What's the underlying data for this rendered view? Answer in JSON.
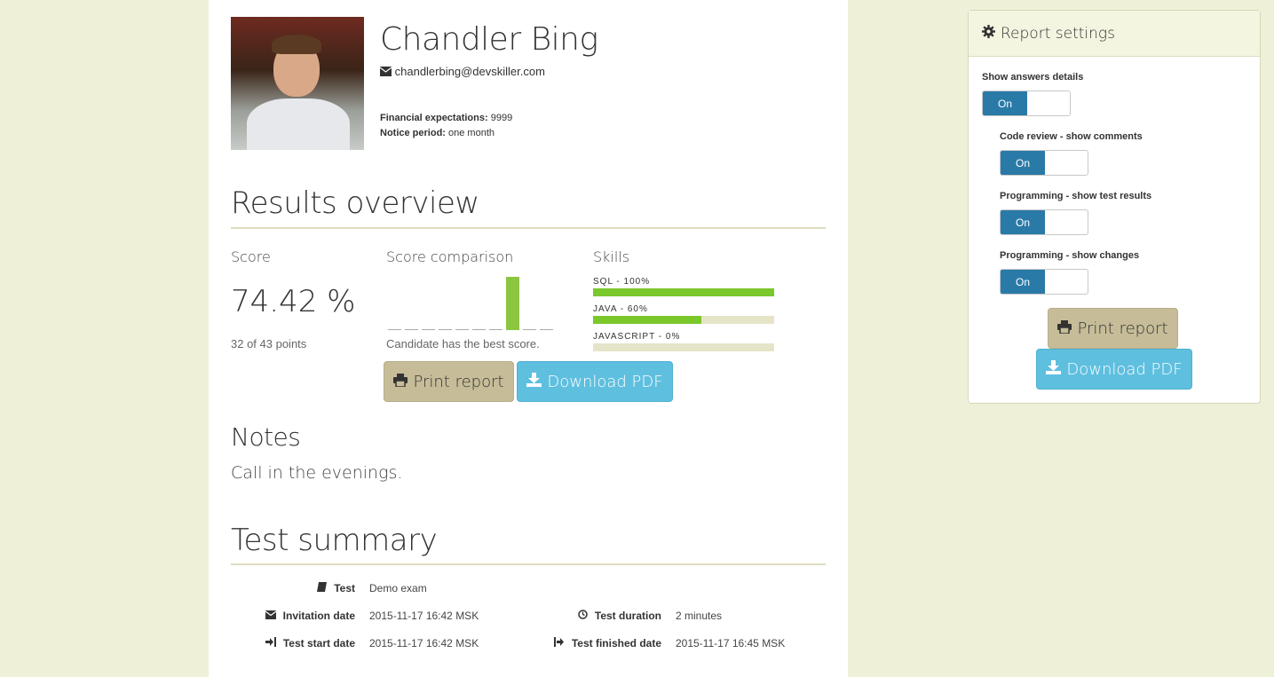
{
  "candidate": {
    "name": "Chandler Bing",
    "email": "chandlerbing@devskiller.com",
    "financial_label": "Financial expectations:",
    "financial_value": "9999",
    "notice_label": "Notice period:",
    "notice_value": "one month"
  },
  "results": {
    "title": "Results overview",
    "score_label": "Score",
    "score_value": "74.42 %",
    "points_text": "32 of 43 points",
    "comparison_label": "Score comparison",
    "comparison_note": "Candidate has the best score.",
    "comparison_levels": [
      0,
      0,
      0,
      0,
      0,
      0,
      0,
      1,
      0,
      0
    ],
    "skills_label": "Skills",
    "skills": [
      {
        "label": "SQL - 100%",
        "percent": 100
      },
      {
        "label": "JAVA - 60%",
        "percent": 60
      },
      {
        "label": "JAVASCRIPT - 0%",
        "percent": 0
      }
    ],
    "print_label": "Print report",
    "pdf_label": "Download PDF"
  },
  "notes": {
    "title": "Notes",
    "text": "Call in the evenings."
  },
  "summary": {
    "title": "Test summary",
    "test_label": "Test",
    "test_value": "Demo exam",
    "invitation_label": "Invitation date",
    "invitation_value": "2015-11-17 16:42 MSK",
    "duration_label": "Test duration",
    "duration_value": "2 minutes",
    "start_label": "Test start date",
    "start_value": "2015-11-17 16:42 MSK",
    "finished_label": "Test finished date",
    "finished_value": "2015-11-17 16:45 MSK"
  },
  "settings": {
    "title": "Report settings",
    "items": [
      {
        "label": "Show answers details",
        "state": "On"
      },
      {
        "label": "Code review - show comments",
        "state": "On"
      },
      {
        "label": "Programming - show test results",
        "state": "On"
      },
      {
        "label": "Programming - show changes",
        "state": "On"
      }
    ],
    "print_label": "Print report",
    "pdf_label": "Download PDF"
  },
  "colors": {
    "background": "#eef0d8",
    "accent_toggle": "#2a7aa8",
    "pdf_button": "#5ebfdf",
    "print_button": "#c6bc98",
    "skill_fill": "#7ac82c",
    "comparison_best": "#8cc63f"
  }
}
